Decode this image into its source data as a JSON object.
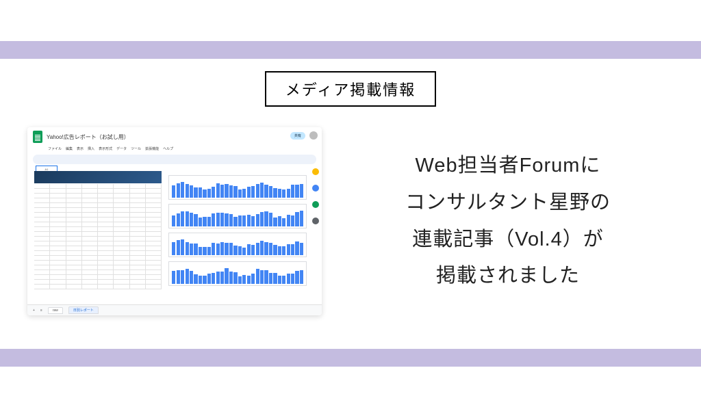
{
  "badge_label": "メディア掲載情報",
  "headline": {
    "line1": "Web担当者Forumに",
    "line2": "コンサルタント星野の",
    "line3": "連載記事（Vol.4）が",
    "line4": "掲載されました"
  },
  "thumb": {
    "doc_title": "Yahoo!広告レポート（お試し用）",
    "menu": [
      "ファイル",
      "編集",
      "表示",
      "挿入",
      "表示形式",
      "データ",
      "ツール",
      "拡張機能",
      "ヘルプ"
    ],
    "share_label": "共有",
    "cell_ref": "A1",
    "tabs": {
      "raw": "raw",
      "active": "日別レポート"
    },
    "footer_controls": {
      "plus": "+",
      "menu": "≡"
    }
  },
  "side_icon_colors": [
    "#fbbc04",
    "#4285f4",
    "#0f9d58",
    "#5f6368"
  ]
}
